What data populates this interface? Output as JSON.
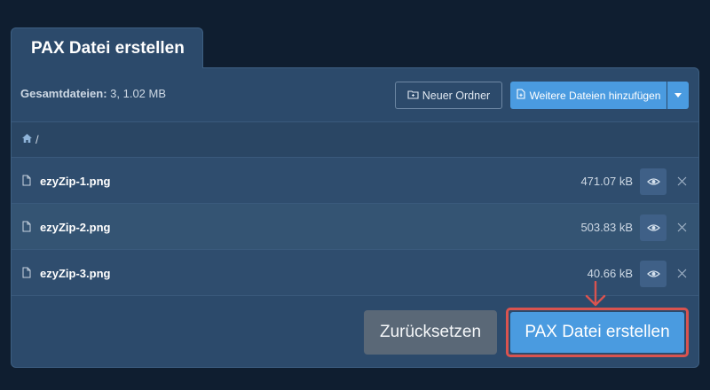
{
  "tab": {
    "title": "PAX Datei erstellen"
  },
  "toolbar": {
    "summary_label": "Gesamtdateien:",
    "summary_value": " 3, 1.02 MB",
    "new_folder_label": "Neuer Ordner",
    "add_files_label": "Weitere Dateien hinzufügen"
  },
  "breadcrumb": {
    "separator": "/"
  },
  "files": [
    {
      "name": "ezyZip-1.png",
      "size": "471.07 kB"
    },
    {
      "name": "ezyZip-2.png",
      "size": "503.83 kB"
    },
    {
      "name": "ezyZip-3.png",
      "size": "40.66 kB"
    }
  ],
  "actions": {
    "reset_label": "Zurücksetzen",
    "create_label": "PAX Datei erstellen"
  },
  "colors": {
    "background": "#0f1e30",
    "panel": "#2c4a6b",
    "primary": "#4a9be0",
    "secondary": "#5a6877",
    "highlight": "#d9534f"
  }
}
